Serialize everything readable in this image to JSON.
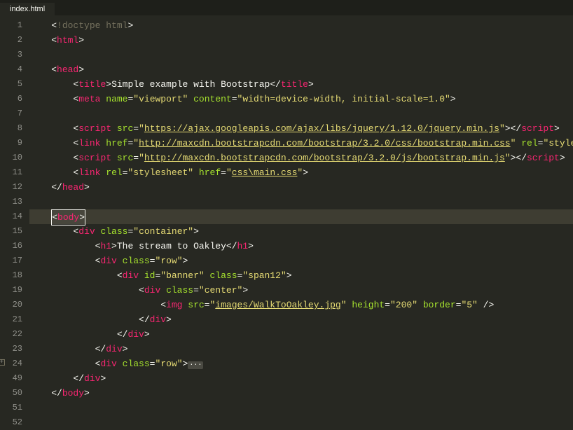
{
  "tab": {
    "title": "index.html"
  },
  "gutter": [
    "1",
    "2",
    "3",
    "4",
    "5",
    "6",
    "7",
    "8",
    "9",
    "10",
    "11",
    "12",
    "13",
    "14",
    "15",
    "16",
    "17",
    "18",
    "19",
    "20",
    "21",
    "22",
    "23",
    "24",
    "49",
    "50",
    "51",
    "52"
  ],
  "folded_line_index": 23,
  "highlighted_line_index": 13,
  "code": {
    "doctype": "!doctype html",
    "html_open": "html",
    "html_close": "html",
    "head_open": "head",
    "head_close": "head",
    "body_open": "body",
    "body_close": "body",
    "title_tag": "title",
    "title_text": "Simple example with Bootstrap",
    "meta_tag": "meta",
    "meta_name_attr": "name",
    "meta_name_val": "viewport",
    "meta_content_attr": "content",
    "meta_content_val": "width=device-width, initial-scale=1.0",
    "script_tag": "script",
    "link_tag": "link",
    "src_attr": "src",
    "href_attr": "href",
    "rel_attr": "rel",
    "rel_stylesheet": "stylesheet",
    "rel_styleshe_cut": "styleshe",
    "url_jquery": "https://ajax.googleapis.com/ajax/libs/jquery/1.12.0/jquery.min.js",
    "url_bootstrap_css": "http://maxcdn.bootstrapcdn.com/bootstrap/3.2.0/css/bootstrap.min.css",
    "url_bootstrap_js": "http://maxcdn.bootstrapcdn.com/bootstrap/3.2.0/js/bootstrap.min.js",
    "url_main_css": "css\\main.css",
    "div_tag": "div",
    "h1_tag": "h1",
    "img_tag": "img",
    "class_attr": "class",
    "id_attr": "id",
    "height_attr": "height",
    "border_attr": "border",
    "cls_container": "container",
    "cls_row": "row",
    "cls_span12": "span12",
    "cls_center": "center",
    "id_banner": "banner",
    "h1_text": "The stream to Oakley",
    "img_src": "images/WalkToOakley.jpg",
    "img_height": "200",
    "img_border": "5",
    "fold_dots": "···"
  }
}
